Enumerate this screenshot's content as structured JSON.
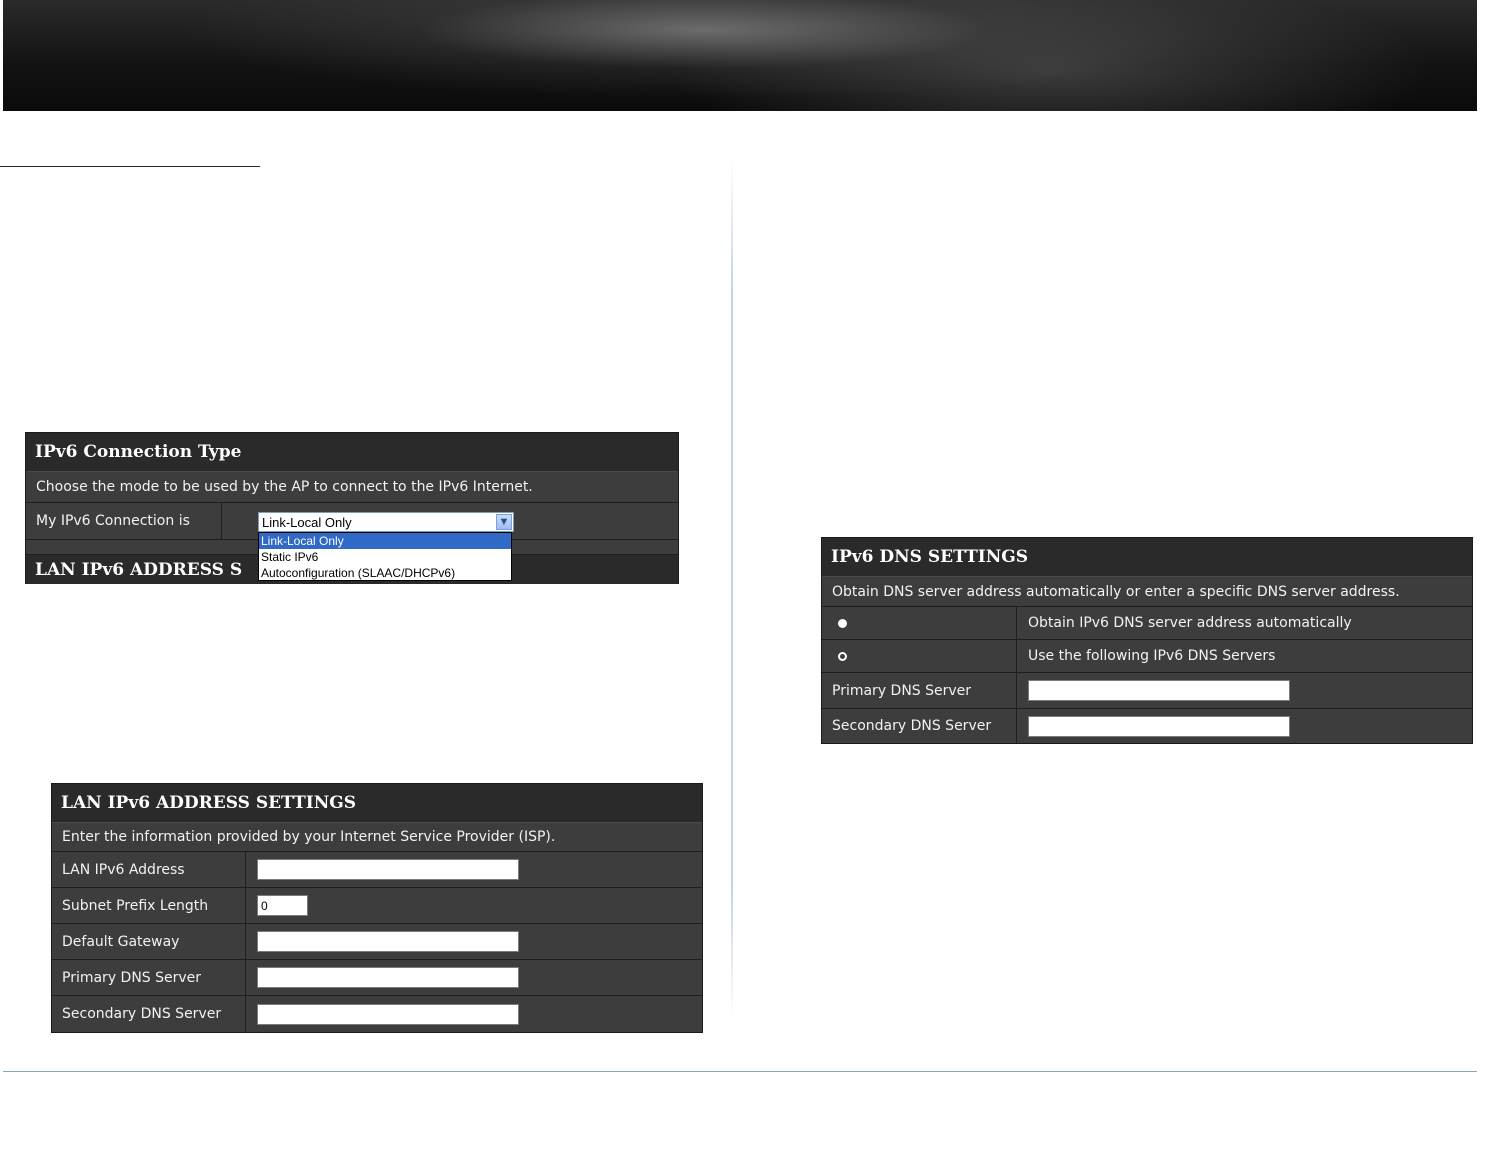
{
  "connection_panel": {
    "title": "IPv6 Connection Type",
    "description": "Choose the mode to be used by the AP to connect to the IPv6 Internet.",
    "field_label": "My IPv6 Connection is",
    "selected_value": "Link-Local Only",
    "options": [
      "Link-Local Only",
      "Static IPv6",
      "Autoconfiguration (SLAAC/DHCPv6)"
    ],
    "next_section_title": "LAN IPv6 ADDRESS S"
  },
  "lan_panel": {
    "title": "LAN IPv6 ADDRESS SETTINGS",
    "description": "Enter the information provided by your Internet Service Provider (ISP).",
    "rows": [
      {
        "label": "LAN IPv6 Address",
        "value": ""
      },
      {
        "label": "Subnet Prefix Length",
        "value": "0"
      },
      {
        "label": "Default Gateway",
        "value": ""
      },
      {
        "label": "Primary DNS Server",
        "value": ""
      },
      {
        "label": "Secondary DNS Server",
        "value": ""
      }
    ]
  },
  "dns_panel": {
    "title": "IPv6 DNS SETTINGS",
    "description": "Obtain DNS server address automatically or enter a specific DNS server address.",
    "options": [
      {
        "label": "Obtain IPv6 DNS server address automatically",
        "checked": false
      },
      {
        "label": "Use the following IPv6 DNS Servers",
        "checked": true
      }
    ],
    "rows": [
      {
        "label": "Primary DNS Server",
        "value": ""
      },
      {
        "label": "Secondary DNS Server",
        "value": ""
      }
    ]
  }
}
